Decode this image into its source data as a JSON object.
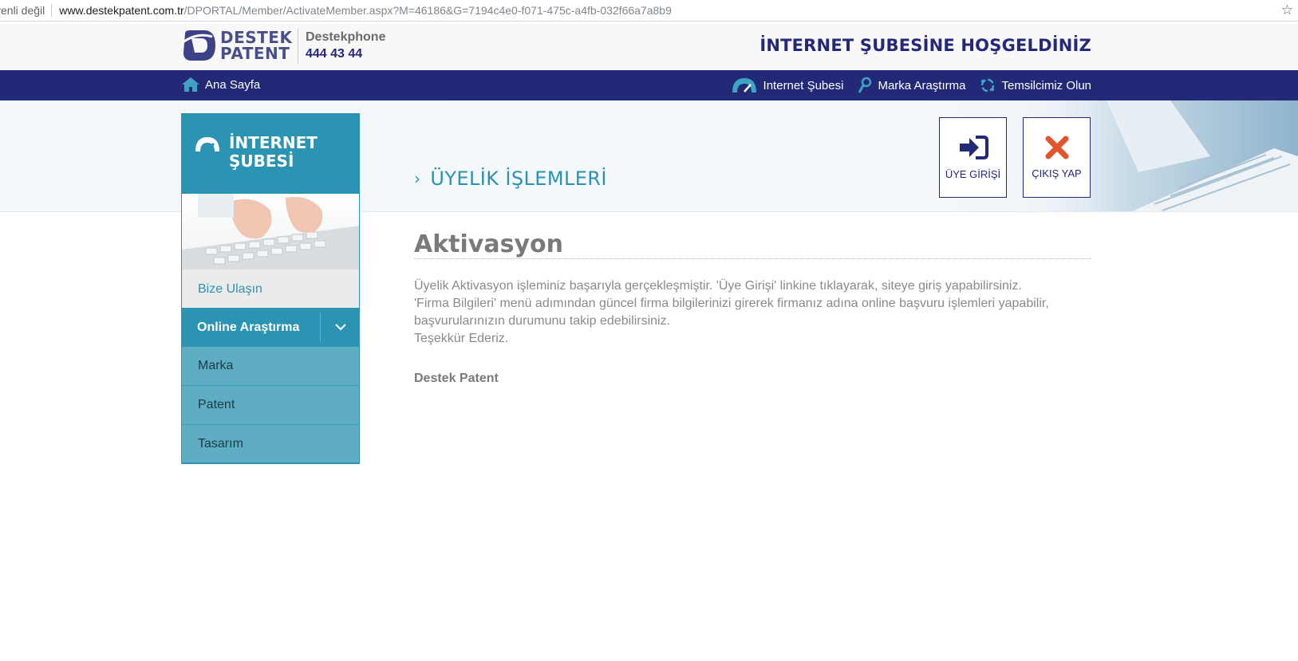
{
  "browser": {
    "security_label": "venli değil",
    "url_host": "www.destekpatent.com.tr",
    "url_path": "/DPORTAL/Member/ActivateMember.aspx?M=46186&G=7194c4e0-f071-475c-a4fb-032f66a7a8b9",
    "star_icon": "star-icon"
  },
  "header": {
    "logo_line1": "DESTEK",
    "logo_line2": "PATENT",
    "phone_label": "Destekphone",
    "phone_number": "444 43 44",
    "welcome": "İNTERNET ŞUBESİNE HOŞGELDİNİZ"
  },
  "nav": {
    "home": "Ana Sayfa",
    "items": [
      {
        "label": "Internet Şubesi",
        "icon": "dashboard-icon"
      },
      {
        "label": "Marka Araştırma",
        "icon": "search-icon"
      },
      {
        "label": "Temsilcimiz Olun",
        "icon": "handshake-icon"
      }
    ]
  },
  "banner": {
    "title": "ÜYELİK İŞLEMLERİ",
    "login_label": "ÜYE GİRİŞİ",
    "logout_label": "ÇIKIŞ YAP"
  },
  "sidebar": {
    "title_line1": "İNTERNET",
    "title_line2": "ŞUBESİ",
    "contact": "Bize Ulaşın",
    "online": "Online Araştırma",
    "sub_items": [
      "Marka",
      "Patent",
      "Tasarım"
    ]
  },
  "content": {
    "title": "Aktivasyon",
    "line1": "Üyelik Aktivasyon işleminiz başarıyla gerçekleşmiştir. 'Üye Girişi' linkine tıklayarak, siteye giriş yapabilirsiniz.",
    "line2": "'Firma Bilgileri' menü adımından güncel firma bilgilerinizi girerek firmanız adına online başvuru işlemleri yapabilir,",
    "line3": "başvurularınızın durumunu takip edebilirsiniz.",
    "line4": "Teşekkür Ederiz.",
    "signature": "Destek Patent"
  },
  "colors": {
    "navy": "#222a78",
    "teal": "#2a94b2",
    "light_teal": "#5eadc2",
    "logout_red": "#e2542b"
  }
}
